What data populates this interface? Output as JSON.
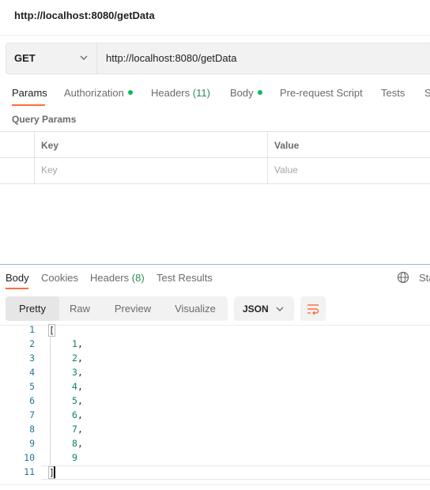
{
  "title": "http://localhost:8080/getData",
  "request": {
    "method": "GET",
    "url": "http://localhost:8080/getData"
  },
  "request_tabs": {
    "params": "Params",
    "authorization": "Authorization",
    "headers": "Headers",
    "headers_count": "(11)",
    "body": "Body",
    "pre_request_script": "Pre-request Script",
    "tests": "Tests",
    "settings_cut": "S"
  },
  "query_params": {
    "title": "Query Params",
    "columns": [
      "Key",
      "Value"
    ],
    "placeholder_key": "Key",
    "placeholder_value": "Value"
  },
  "response_tabs": {
    "body": "Body",
    "cookies": "Cookies",
    "headers": "Headers",
    "headers_count": "(8)",
    "test_results": "Test Results",
    "status_cut": "Sta"
  },
  "view_modes": {
    "pretty": "Pretty",
    "raw": "Raw",
    "preview": "Preview",
    "visualize": "Visualize",
    "selected": "Pretty"
  },
  "format": "JSON",
  "code": {
    "line_numbers": [
      "1",
      "2",
      "3",
      "4",
      "5",
      "6",
      "7",
      "8",
      "9",
      "10",
      "11"
    ],
    "open_bracket": "[",
    "close_bracket": "]",
    "values": [
      "1",
      "2",
      "3",
      "4",
      "5",
      "6",
      "7",
      "8",
      "9"
    ],
    "comma": ","
  },
  "colors": {
    "accent": "#ff6c37",
    "status_dot": "#0cbb52",
    "line_number": "#237893",
    "number": "#098658"
  }
}
